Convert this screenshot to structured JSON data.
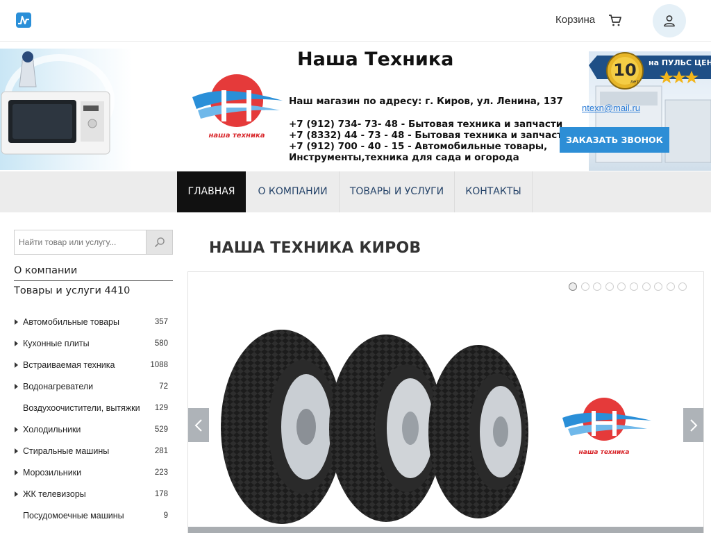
{
  "topbar": {
    "brand_icon": "pulse-logo-icon",
    "cart_label": "Корзина",
    "cart_icon": "cart-icon",
    "user_icon": "user-icon"
  },
  "header": {
    "title": "Наша Техника",
    "address": "Наш магазин по адресу: г. Киров, ул. Ленина, 137",
    "phones": [
      "+7 (912) 734- 73- 48 - Бытовая техника и запчасти",
      "+7 (8332) 44 - 73 - 48 - Бытовая техника и запчасти",
      "+7 (912) 700 - 40 - 15 - Автомобильные товары,",
      "Инструменты,техника для сада и огорода"
    ],
    "email": "ntexn@mail.ru",
    "callback_button": "ЗАКАЗАТЬ ЗВОНОК",
    "logo_caption": "наша техника",
    "badge": {
      "number": "10",
      "years": "лет",
      "text": "на ПУЛЬС ЦЕН"
    }
  },
  "nav": {
    "items": [
      {
        "label": "ГЛАВНАЯ",
        "active": true
      },
      {
        "label": "О КОМПАНИИ",
        "active": false
      },
      {
        "label": "ТОВАРЫ И УСЛУГИ",
        "active": false
      },
      {
        "label": "КОНТАКТЫ",
        "active": false
      }
    ]
  },
  "sidebar": {
    "search_placeholder": "Найти товар или услугу...",
    "about_link": "О компании",
    "goods_link": "Товары и услуги 4410",
    "categories": [
      {
        "name": "Автомобильные товары",
        "count": "357",
        "has_children": true
      },
      {
        "name": "Кухонные плиты",
        "count": "580",
        "has_children": true
      },
      {
        "name": "Встраиваемая техника",
        "count": "1088",
        "has_children": true
      },
      {
        "name": "Водонагреватели",
        "count": "72",
        "has_children": true
      },
      {
        "name": "Воздухоочистители, вытяжки",
        "count": "129",
        "has_children": false
      },
      {
        "name": "Холодильники",
        "count": "529",
        "has_children": true
      },
      {
        "name": "Стиральные машины",
        "count": "281",
        "has_children": true
      },
      {
        "name": "Морозильники",
        "count": "223",
        "has_children": true
      },
      {
        "name": "ЖК телевизоры",
        "count": "178",
        "has_children": true
      },
      {
        "name": "Посудомоечные машины",
        "count": "9",
        "has_children": false
      }
    ]
  },
  "main": {
    "title": "НАША ТЕХНИКА КИРОВ",
    "slider": {
      "slide_count": 10,
      "active_slide": 1,
      "logo_caption": "наша техника",
      "prev_icon": "chevron-left-icon",
      "next_icon": "chevron-right-icon"
    }
  },
  "colors": {
    "accent": "#2d8ed6",
    "nav_active": "#111111",
    "nav_bg": "#ececec",
    "logo_red": "#e53a3a",
    "logo_blue": "#2a8fd8"
  }
}
